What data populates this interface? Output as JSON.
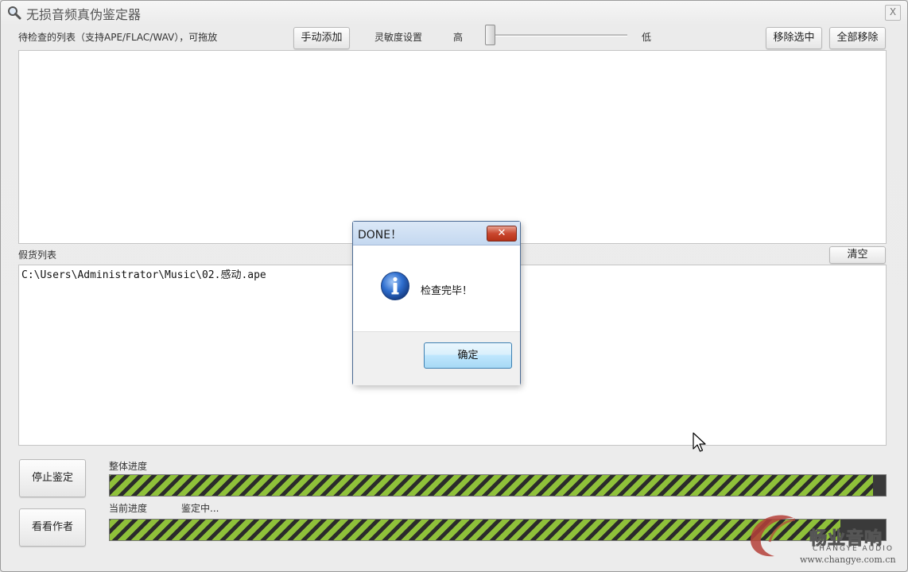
{
  "window": {
    "title": "无损音频真伪鉴定器",
    "close_glyph": "X"
  },
  "toolbar": {
    "list_label": "待检查的列表（支持APE/FLAC/WAV），可拖放",
    "manual_add": "手动添加",
    "sensitivity_label": "灵敏度设置",
    "high": "高",
    "low": "低",
    "sensitivity_value": 0.0,
    "remove_selected": "移除选中",
    "remove_all": "全部移除"
  },
  "fake_list": {
    "label": "假货列表",
    "clear": "清空",
    "items": [
      "C:\\Users\\Administrator\\Music\\02.感动.ape"
    ]
  },
  "bottom": {
    "stop_button": "停止鉴定",
    "author_button": "看看作者",
    "overall_label": "整体进度",
    "overall_progress": 0.984,
    "current_label": "当前进度",
    "current_status": "鉴定中...",
    "current_progress": 0.942
  },
  "dialog": {
    "title": "DONE！",
    "message": "检查完毕！",
    "ok": "确定",
    "close_glyph": "✕"
  },
  "watermark": {
    "cn": "畅业音响",
    "en": "CHANGYE AUDIO",
    "url": "www.changye.com.cn"
  },
  "colors": {
    "progress_fill": "#8fc13a",
    "dialog_title": "#c4d8f0",
    "info_icon": "#1f5fbf"
  }
}
